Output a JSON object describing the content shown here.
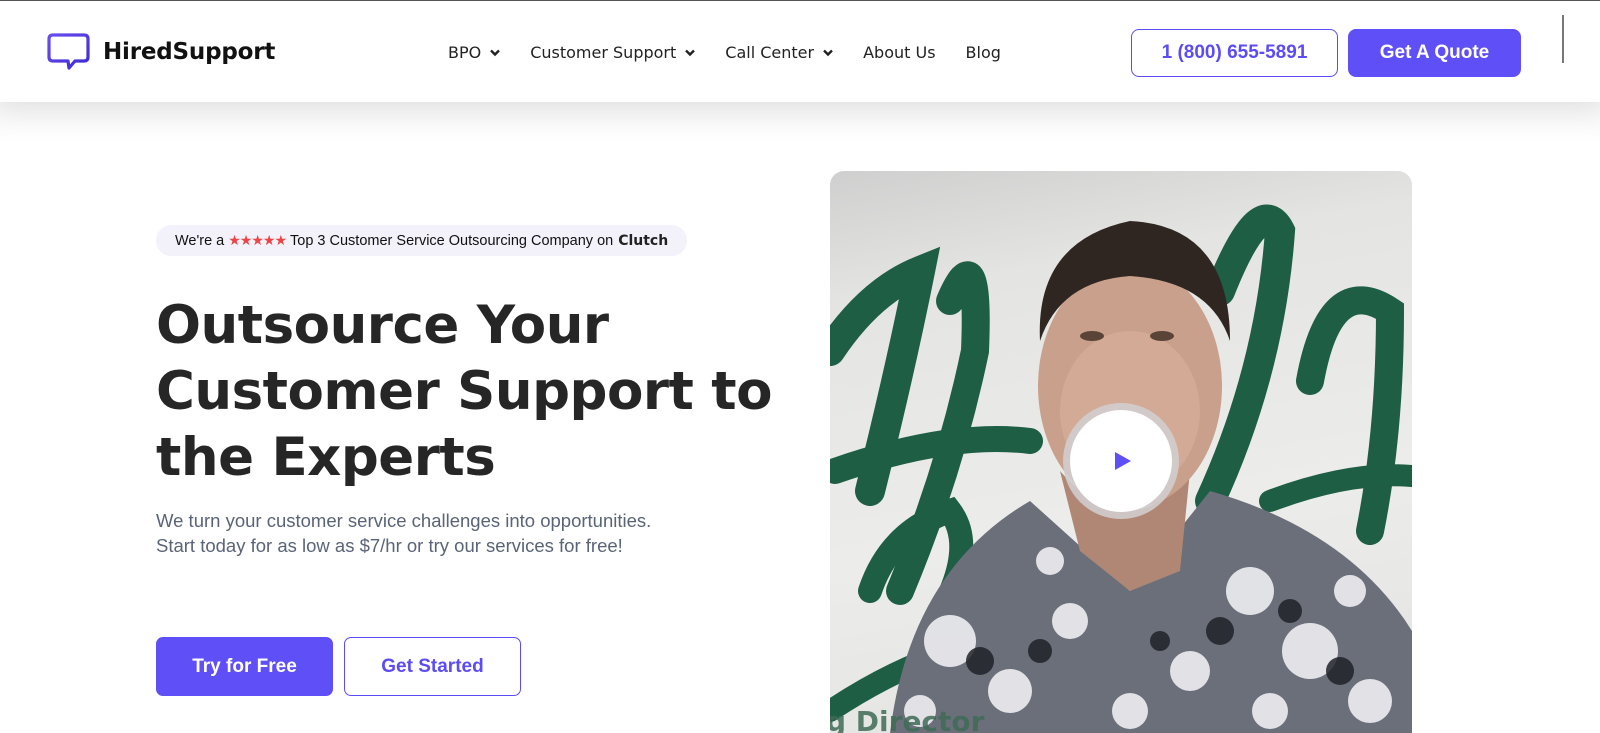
{
  "header": {
    "brand": "HiredSupport",
    "nav": [
      {
        "label": "BPO",
        "has_dropdown": true
      },
      {
        "label": "Customer Support",
        "has_dropdown": true
      },
      {
        "label": "Call Center",
        "has_dropdown": true
      },
      {
        "label": "About Us",
        "has_dropdown": false
      },
      {
        "label": "Blog",
        "has_dropdown": false
      }
    ],
    "phone": "1 (800) 655-5891",
    "quote_label": "Get A Quote"
  },
  "hero": {
    "badge": {
      "prefix": "We're a",
      "stars": "★★★★★",
      "text": "Top 3 Customer Service Outsourcing Company on",
      "brand": "Clutch"
    },
    "title_lines": [
      "Outsource Your",
      "Customer Support to",
      "the Experts"
    ],
    "subtitle": "We turn your customer service challenges into opportunities. Start today for as low as $7/hr or try our services for free!",
    "try_label": "Try for Free",
    "start_label": "Get Started",
    "video": {
      "icon": "play-icon",
      "caption_partial": "g Director"
    }
  },
  "colors": {
    "accent": "#5f4ff7",
    "stars": "#ef4444",
    "title": "#262626",
    "subtitle": "#5a6478"
  }
}
